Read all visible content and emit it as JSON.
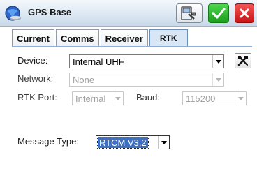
{
  "window": {
    "title": "GPS Base",
    "icon": "gps-globe-icon",
    "toolbar_icon": "settings-device-icon",
    "ok_icon": "checkmark-icon",
    "close_icon": "close-icon",
    "ok_color": "#2fb52f",
    "close_color": "#e02020"
  },
  "tabs": [
    {
      "label": "Current",
      "active": false
    },
    {
      "label": "Comms",
      "active": false
    },
    {
      "label": "Receiver",
      "active": false
    },
    {
      "label": "RTK",
      "active": true
    }
  ],
  "form": {
    "device": {
      "label": "Device:",
      "value": "Internal UHF",
      "enabled": true
    },
    "network": {
      "label": "Network:",
      "value": "None",
      "enabled": false
    },
    "rtk_port": {
      "label": "RTK Port:",
      "value": "Internal",
      "enabled": false
    },
    "baud": {
      "label": "Baud:",
      "value": "115200",
      "enabled": false
    },
    "message_type": {
      "label": "Message Type:",
      "value": "RTCM V3.2",
      "enabled": true
    }
  }
}
